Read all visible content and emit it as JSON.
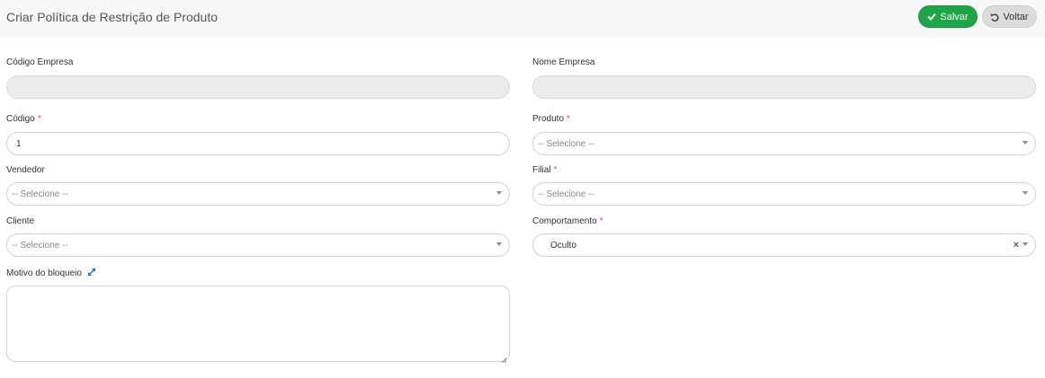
{
  "header": {
    "title": "Criar Política de Restrição de Produto",
    "save_label": "Salvar",
    "back_label": "Voltar"
  },
  "form": {
    "codigo_empresa": {
      "label": "Código Empresa",
      "value": ""
    },
    "nome_empresa": {
      "label": "Nome Empresa",
      "value": ""
    },
    "codigo": {
      "label": "Código",
      "required": "*",
      "value": "1"
    },
    "produto": {
      "label": "Produto",
      "required": "*",
      "value": "-- Selecione --"
    },
    "vendedor": {
      "label": "Vendedor",
      "value": "-- Selecione --"
    },
    "filial": {
      "label": "Filial",
      "required": "*",
      "value": "-- Selecione --"
    },
    "cliente": {
      "label": "Cliente",
      "value": "-- Selecione --"
    },
    "comportamento": {
      "label": "Comportamento",
      "required": "*",
      "value": "Oculto",
      "clear": "×"
    },
    "motivo_bloqueio": {
      "label": "Motivo do bloqueio",
      "value": ""
    }
  },
  "colors": {
    "save": "#1ea548",
    "back": "#dcdcdc",
    "required": "#d9534f",
    "expand_icon": "#1a6fc4"
  }
}
